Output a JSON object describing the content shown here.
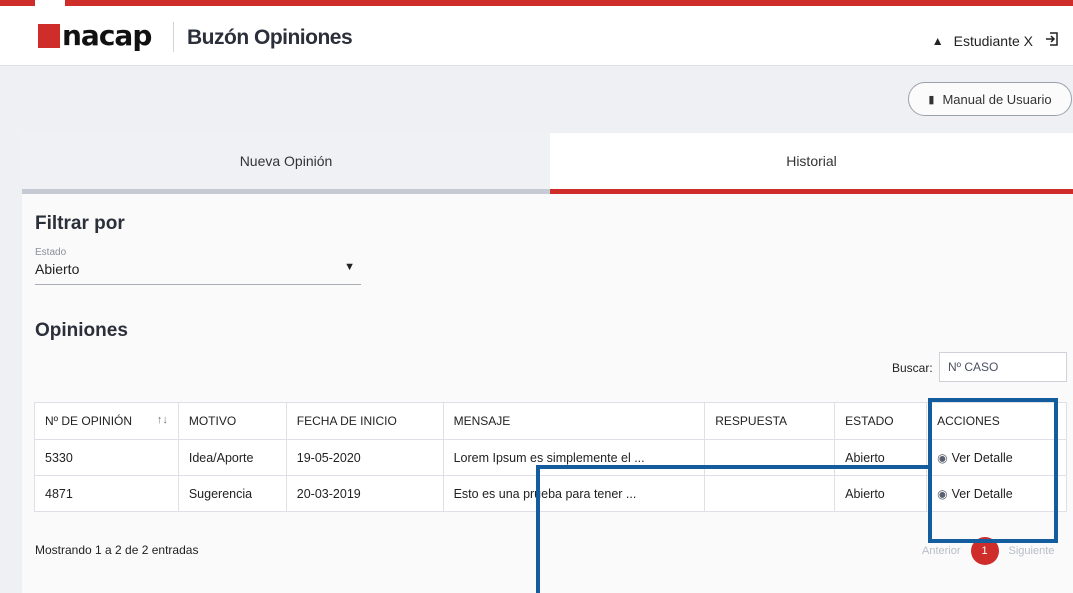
{
  "header": {
    "logo_text": "nacap",
    "app_title": "Buzón Opiniones",
    "user_name": "Estudiante X",
    "user_icon": "user-icon",
    "logout_icon": "logout-icon"
  },
  "manual_button": {
    "label": "Manual de Usuario",
    "icon": "document-icon"
  },
  "tabs": [
    {
      "label": "Nueva Opinión",
      "active": false
    },
    {
      "label": "Historial",
      "active": true
    }
  ],
  "filter": {
    "heading": "Filtrar por",
    "estado_label": "Estado",
    "estado_value": "Abierto"
  },
  "opinions": {
    "heading": "Opiniones",
    "search_label": "Buscar:",
    "search_placeholder": "Nº CASO",
    "columns": [
      "Nº DE OPINIÓN",
      "MOTIVO",
      "FECHA DE INICIO",
      "MENSAJE",
      "RESPUESTA",
      "ESTADO",
      "ACCIONES"
    ],
    "rows": [
      {
        "id": "5330",
        "motivo": "Idea/Aporte",
        "fecha": "19-05-2020",
        "mensaje": "Lorem Ipsum es simplemente el ...",
        "respuesta": "",
        "estado": "Abierto",
        "accion": "Ver Detalle"
      },
      {
        "id": "4871",
        "motivo": "Sugerencia",
        "fecha": "20-03-2019",
        "mensaje": "Esto es una prueba para tener ...",
        "respuesta": "",
        "estado": "Abierto",
        "accion": "Ver Detalle"
      }
    ],
    "info": "Mostrando 1 a 2 de 2 entradas",
    "pager": {
      "prev": "Anterior",
      "page": "1",
      "next": "Siguiente"
    }
  },
  "colors": {
    "brand_red": "#cf2d2a",
    "highlight_blue": "#135c9e"
  }
}
